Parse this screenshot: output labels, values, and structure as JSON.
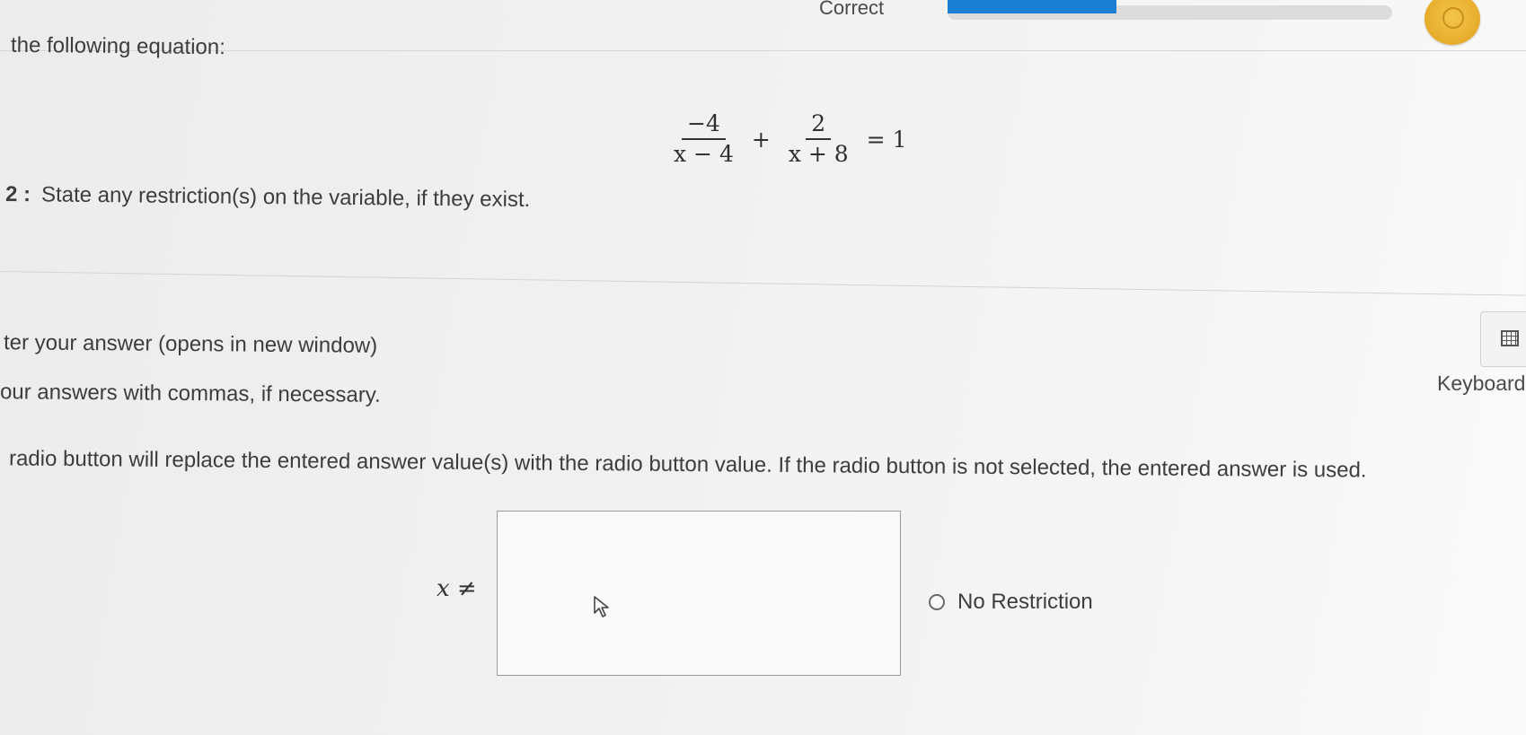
{
  "header": {
    "status": "Correct",
    "progress_fraction": 0.38,
    "badge_icon": "award-icon"
  },
  "question": {
    "intro": "the following equation:",
    "equation": {
      "term1_numerator": "−4",
      "term1_denominator": "x − 4",
      "operator": "+",
      "term2_numerator": "2",
      "term2_denominator": "x + 8",
      "equals": "=",
      "rhs": "1"
    },
    "step_label": "2 :",
    "step_text": "State any restriction(s) on the variable, if they exist."
  },
  "instructions": {
    "line1": "ter your answer (opens in new window)",
    "line2": "our answers with commas, if necessary.",
    "line3": "radio button will replace the entered answer value(s) with the radio button value. If the radio button is not selected, the entered answer is used."
  },
  "keyboard": {
    "label": "Keyboard",
    "icon": "keyboard-icon"
  },
  "answer": {
    "prefix": "x ≠",
    "value": "",
    "radio_label": "No Restriction",
    "radio_selected": false
  }
}
